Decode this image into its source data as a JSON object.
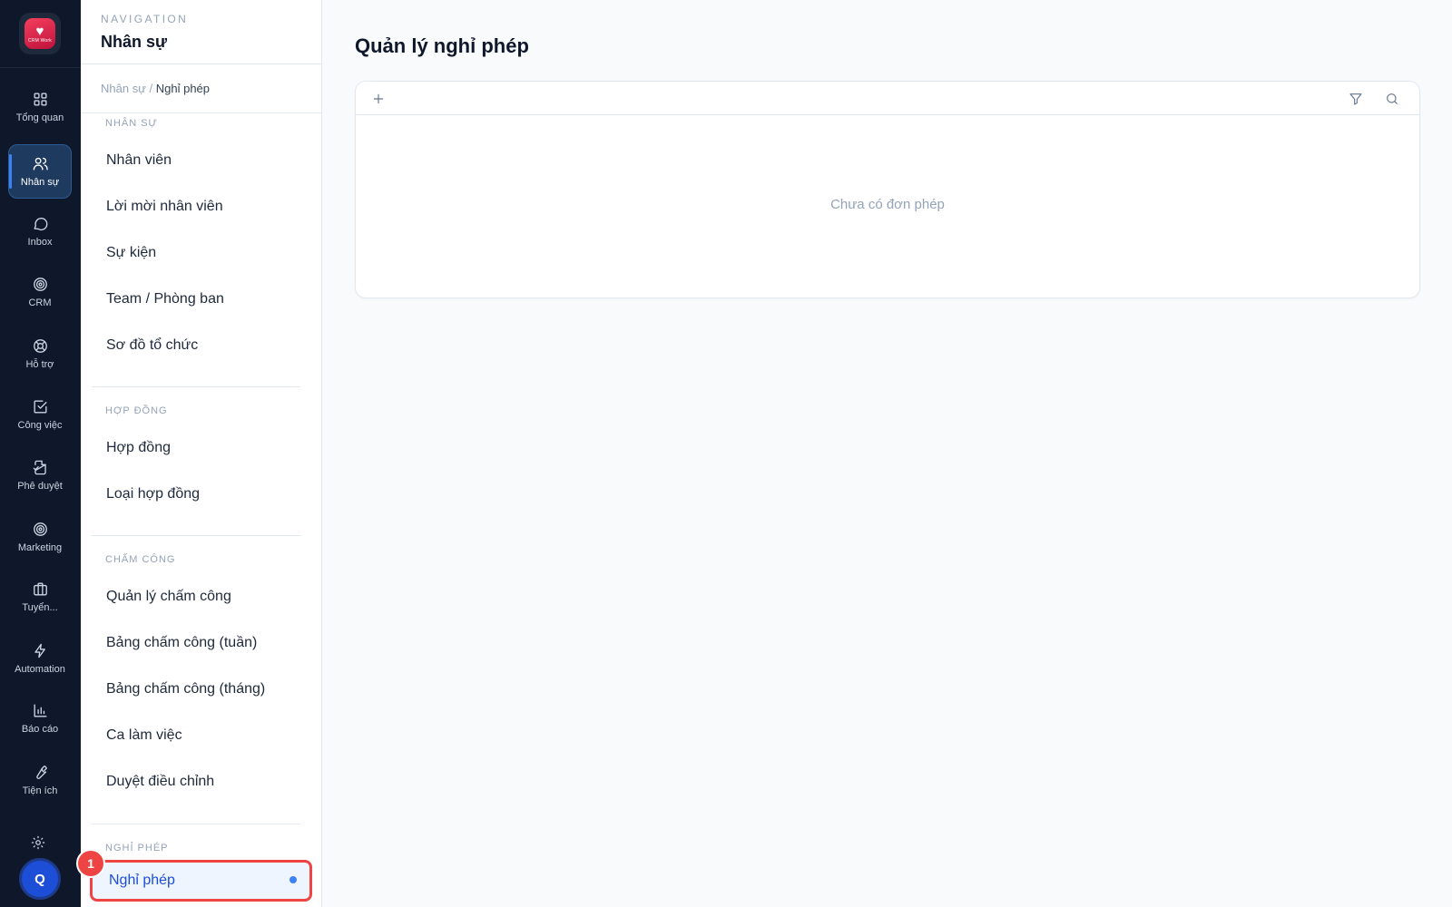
{
  "app": {
    "logo_text": "CRM Work"
  },
  "rail": {
    "items": [
      {
        "label": "Tổng quan",
        "icon": "grid-icon"
      },
      {
        "label": "Nhân sự",
        "icon": "users-icon",
        "active": true
      },
      {
        "label": "Inbox",
        "icon": "chat-icon"
      },
      {
        "label": "CRM",
        "icon": "target-icon"
      },
      {
        "label": "Hỗ trợ",
        "icon": "lifebuoy-icon"
      },
      {
        "label": "Công việc",
        "icon": "check-square-icon"
      },
      {
        "label": "Phê duyệt",
        "icon": "file-sign-icon"
      },
      {
        "label": "Marketing",
        "icon": "target-icon"
      },
      {
        "label": "Tuyển...",
        "icon": "briefcase-icon"
      },
      {
        "label": "Automation",
        "icon": "bolt-icon"
      },
      {
        "label": "Báo cáo",
        "icon": "bar-chart-icon"
      },
      {
        "label": "Tiện ích",
        "icon": "wrench-icon"
      }
    ],
    "avatar_initial": "Q"
  },
  "nav": {
    "kicker": "NAVIGATION",
    "title": "Nhân sự",
    "breadcrumb": {
      "parent": "Nhân sự /",
      "current": "Nghỉ phép"
    },
    "groups": [
      {
        "title": "NHÂN SỰ",
        "items": [
          "Nhân viên",
          "Lời mời nhân viên",
          "Sự kiện",
          "Team / Phòng ban",
          "Sơ đồ tổ chức"
        ]
      },
      {
        "title": "HỢP ĐỒNG",
        "items": [
          "Hợp đồng",
          "Loại hợp đồng"
        ]
      },
      {
        "title": "CHẤM CÔNG",
        "items": [
          "Quản lý chấm công",
          "Bảng chấm công (tuần)",
          "Bảng chấm công (tháng)",
          "Ca làm việc",
          "Duyệt điều chỉnh"
        ]
      },
      {
        "title": "NGHỈ PHÉP",
        "items": [
          "Nghỉ phép"
        ]
      }
    ],
    "badge": "1"
  },
  "main": {
    "title": "Quản lý nghỉ phép",
    "empty_text": "Chưa có đơn phép"
  },
  "colors": {
    "rail_bg": "#0f172a",
    "accent": "#3b82f6",
    "highlight": "#ef4444"
  }
}
